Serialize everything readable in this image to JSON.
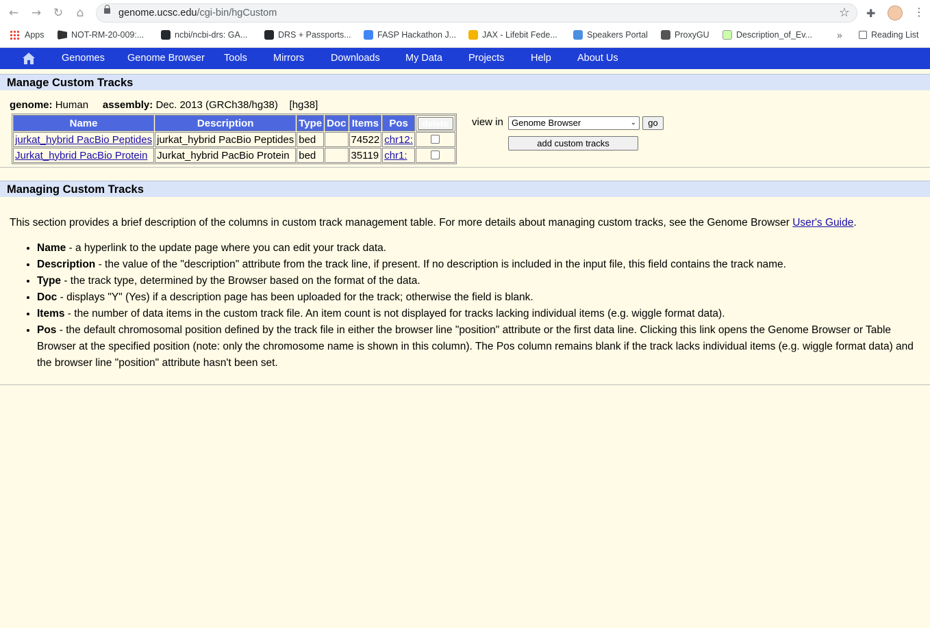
{
  "browser": {
    "url_host": "genome.ucsc.edu",
    "url_path": "/cgi-bin/hgCustom",
    "bookmarks": [
      {
        "label": "Apps",
        "icon": "apps-grid-icon"
      },
      {
        "label": "NOT-RM-20-009:...",
        "icon": "nih-icon"
      },
      {
        "label": "ncbi/ncbi-drs: GA...",
        "icon": "github-icon"
      },
      {
        "label": "DRS + Passports...",
        "icon": "github-icon"
      },
      {
        "label": "FASP Hackathon J...",
        "icon": "google-docs-icon"
      },
      {
        "label": "JAX - Lifebit Fede...",
        "icon": "slides-icon"
      },
      {
        "label": "Speakers Portal",
        "icon": "zoom-icon"
      },
      {
        "label": "ProxyGU",
        "icon": "globe-icon"
      },
      {
        "label": "Description_of_Ev...",
        "icon": "doc-icon"
      }
    ],
    "more_label": "»",
    "reading_list": "Reading List"
  },
  "nav": {
    "items": [
      "Genomes",
      "Genome Browser",
      "Tools",
      "Mirrors",
      "Downloads",
      "My Data",
      "Projects",
      "Help",
      "About Us"
    ]
  },
  "manage": {
    "title": "Manage Custom Tracks",
    "genome_label": "genome:",
    "genome_value": "Human",
    "assembly_label": "assembly:",
    "assembly_value": "Dec. 2013 (GRCh38/hg38)",
    "db": "[hg38]",
    "columns": [
      "Name",
      "Description",
      "Type",
      "Doc",
      "Items",
      "Pos"
    ],
    "delete_label": "delete",
    "rows": [
      {
        "name": "jurkat_hybrid PacBio Peptides",
        "description": "jurkat_hybrid PacBio Peptides",
        "type": "bed",
        "doc": "",
        "items": "74522",
        "pos": "chr12:"
      },
      {
        "name": "Jurkat_hybrid PacBio Protein",
        "description": "Jurkat_hybrid PacBio Protein",
        "type": "bed",
        "doc": "",
        "items": "35119",
        "pos": "chr1:"
      }
    ],
    "view_in_label": "view in",
    "view_in_selected": "Genome Browser",
    "go_label": "go",
    "add_label": "add custom tracks"
  },
  "help": {
    "title": "Managing Custom Tracks",
    "intro": "This section provides a brief description of the columns in custom track management table. For more details about managing custom tracks, see the Genome Browser ",
    "intro_link": "User's Guide",
    "intro_end": ".",
    "defs": [
      {
        "term": "Name",
        "text": " - a hyperlink to the update page where you can edit your track data."
      },
      {
        "term": "Description",
        "text": " - the value of the \"description\" attribute from the track line, if present. If no description is included in the input file, this field contains the track name."
      },
      {
        "term": "Type",
        "text": " - the track type, determined by the Browser based on the format of the data."
      },
      {
        "term": "Doc",
        "text": " - displays \"Y\" (Yes) if a description page has been uploaded for the track; otherwise the field is blank."
      },
      {
        "term": "Items",
        "text": " - the number of data items in the custom track file. An item count is not displayed for tracks lacking individual items (e.g. wiggle format data)."
      },
      {
        "term": "Pos",
        "text": " - the default chromosomal position defined by the track file in either the browser line \"position\" attribute or the first data line. Clicking this link opens the Genome Browser or Table Browser at the specified position (note: only the chromosome name is shown in this column). The Pos column remains blank if the track lacks individual items (e.g. wiggle format data) and the browser line \"position\" attribute hasn't been set."
      }
    ]
  }
}
